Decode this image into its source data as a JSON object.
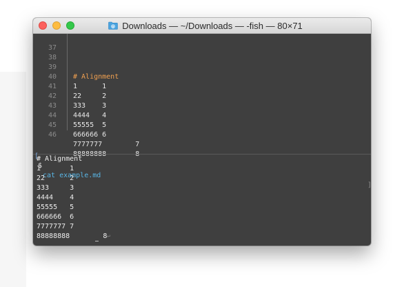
{
  "window": {
    "title": "Downloads — ~/Downloads — -fish — 80×71"
  },
  "icons": {
    "folder": "folder-icon",
    "return": "return-arrow-icon"
  },
  "colors": {
    "terminal_bg": "#3f3f3f",
    "heading": "#f0a050",
    "command": "#59b6e6",
    "close": "#fc605c",
    "minimize": "#fdbc40",
    "zoom": "#34c84a"
  },
  "editor": {
    "lines": [
      {
        "num": "37",
        "text": ""
      },
      {
        "num": "38",
        "text": "# Alignment"
      },
      {
        "num": "39",
        "text": "1      1"
      },
      {
        "num": "40",
        "text": "22     2"
      },
      {
        "num": "41",
        "text": "333    3"
      },
      {
        "num": "42",
        "text": "4444   4"
      },
      {
        "num": "43",
        "text": "55555  5"
      },
      {
        "num": "44",
        "text": "666666 6"
      },
      {
        "num": "45",
        "text": "7777777        7"
      },
      {
        "num": "46",
        "text": "88888888       8"
      }
    ]
  },
  "terminal": {
    "prompt_bracket": "[",
    "prompt_dollar": "$",
    "command": "cat example.md",
    "prompt_end": "]",
    "output": [
      "# Alignment",
      "1       1",
      "22      2",
      "333     3",
      "4444    4",
      "55555   5",
      "666666  6",
      "7777777 7",
      "88888888        8"
    ]
  }
}
